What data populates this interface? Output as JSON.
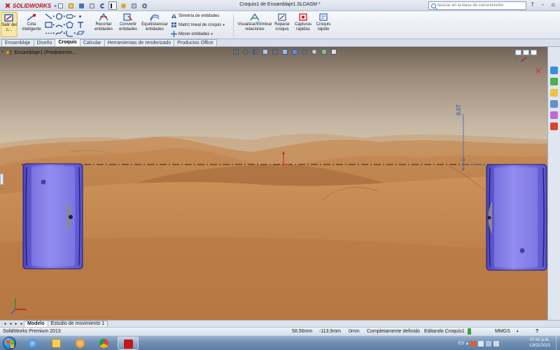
{
  "app": {
    "brand": "SOLIDWORKS",
    "window_title": "Croquis1 de Ensamblaje1.SLDASM *",
    "search_placeholder": "Buscar en la Base de conocimiento"
  },
  "command_manager": {
    "exit_sketch": "Salir del c...",
    "smart_dimension": "Cota inteligente",
    "trim": "Recortar entidades",
    "convert": "Convertir entidades",
    "offset": "Equidistanciar entidades",
    "mirror": "Simetría de entidades",
    "linear_pattern": "Matriz lineal de croquis",
    "move": "Mover entidades",
    "display_relations": "Visualizar/Eliminar relaciones",
    "repair": "Reparar croquis",
    "quick_snaps": "Capturas rápidas",
    "rapid_sketch": "Croquis rápido"
  },
  "tabs": [
    "Ensamblaje",
    "Diseño",
    "Croquis",
    "Calcular",
    "Herramientas de renderizado",
    "Productos Office"
  ],
  "active_tab": "Croquis",
  "feature_tree": {
    "root": "Ensamblaje1 (Predetermin..."
  },
  "viewport": {
    "dimension_value": "0.07",
    "part_color": "#7b74e6",
    "centerline_color": "#2a2424"
  },
  "bottom_tabs": [
    "Modelo",
    "Estudio de movimiento 1"
  ],
  "active_bottom_tab": "Modelo",
  "status_bar": {
    "product": "SolidWorks Premium 2013",
    "x": "58.56mm",
    "y": "-113.9mm",
    "z": "0mm",
    "definition": "Completamente definido",
    "editing": "Editando Croquis1",
    "units": "MMGS",
    "help": "?"
  },
  "taskbar": {
    "language": "ES",
    "time": "07:42 p.m.",
    "date": "13/02/2013"
  },
  "icons": [
    "sketch-icon",
    "smart-dimension-icon",
    "line-icon",
    "circle-icon",
    "rectangle-icon",
    "arc-icon",
    "spline-icon",
    "trim-icon",
    "convert-icon",
    "offset-icon",
    "mirror-icon",
    "pattern-icon",
    "move-icon",
    "relations-icon",
    "repair-icon",
    "snaps-icon",
    "rapid-sketch-icon"
  ]
}
